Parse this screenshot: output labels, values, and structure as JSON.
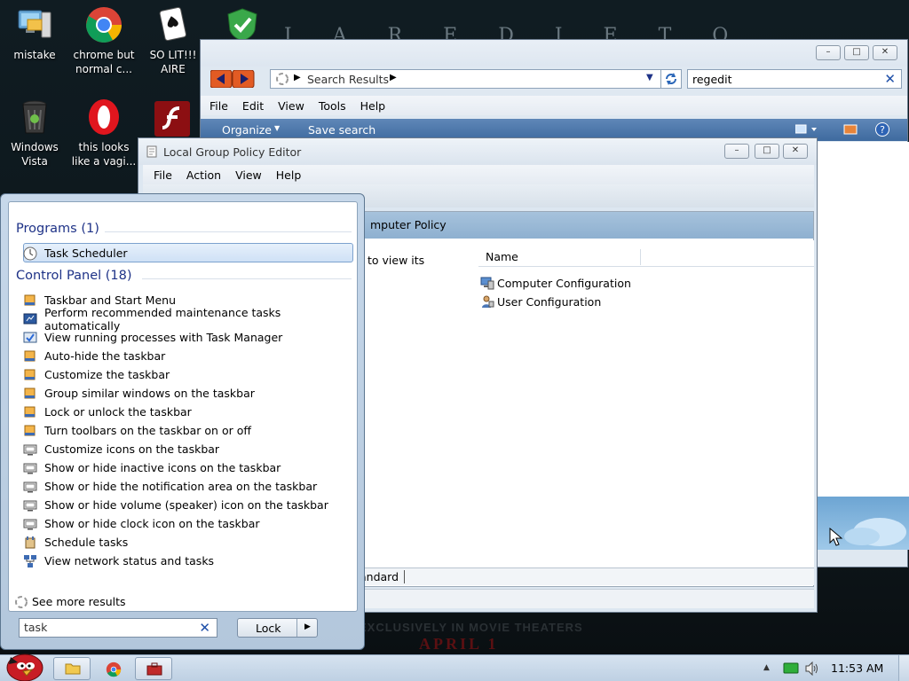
{
  "desktop": {
    "icons": [
      {
        "label": "mistake"
      },
      {
        "label": "chrome but normal c..."
      },
      {
        "label": "SO LIT!!! AIRE"
      },
      {
        "label": "Windows Vista"
      },
      {
        "label": "this looks like a vagi..."
      }
    ],
    "wallpaper_tag": "EXCLUSIVELY IN MOVIE THEATERS",
    "wallpaper_date": "APRIL 1"
  },
  "explorer": {
    "address_text": "Search Results",
    "search_value": "regedit",
    "menu": [
      "File",
      "Edit",
      "View",
      "Tools",
      "Help"
    ],
    "organize_label": "Organize",
    "save_search_label": "Save search"
  },
  "gpo": {
    "title": "Local Group Policy Editor",
    "menu": [
      "File",
      "Action",
      "View",
      "Help"
    ],
    "header_text": "mputer Policy",
    "left_text": "to view its",
    "column_name": "Name",
    "items": [
      "Computer Configuration",
      "User Configuration"
    ],
    "tab_label": "andard"
  },
  "start_menu": {
    "programs_heading": "Programs (1)",
    "programs": [
      "Task Scheduler"
    ],
    "control_panel_heading": "Control Panel (18)",
    "control_panel_items": [
      "Taskbar and Start Menu",
      "Perform recommended maintenance tasks automatically",
      "View running processes with Task Manager",
      "Auto-hide the taskbar",
      "Customize the taskbar",
      "Group similar windows on the taskbar",
      "Lock or unlock the taskbar",
      "Turn toolbars on the taskbar on or off",
      "Customize icons on the taskbar",
      "Show or hide inactive icons on the taskbar",
      "Show or hide the notification area on the taskbar",
      "Show or hide volume (speaker) icon on the taskbar",
      "Show or hide clock icon on the taskbar",
      "Schedule tasks",
      "View network status and tasks"
    ],
    "see_more": "See more results",
    "search_value": "task",
    "lock_label": "Lock"
  },
  "taskbar": {
    "clock": "11:53 AM"
  },
  "colors": {
    "heading_blue": "#1e3287",
    "selection": "#cfe1f6",
    "taskbar": "#c9d8e8"
  }
}
